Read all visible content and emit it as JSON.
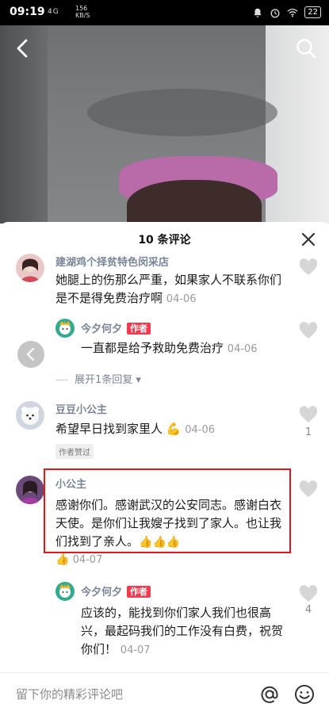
{
  "status": {
    "time": "09:19",
    "network": "4G",
    "speed_top": "156",
    "speed_bottom": "KB/S",
    "battery": "22"
  },
  "header": {
    "title": "10 条评论"
  },
  "comments": [
    {
      "name": "建湖鸡个择贫特色闵采店",
      "text": "她腿上的伤那么严重，如果家人不联系你们是不是得免费治疗啊",
      "date": "04-06"
    },
    {
      "reply_name": "今夕何夕",
      "badge": "作者",
      "reply_text": "一直都是给予救助免费治疗",
      "reply_date": "04-06",
      "expand": "展开1条回复"
    },
    {
      "name": "豆豆小公主",
      "text": "希望早日找到家里人",
      "date": "04-06",
      "likes": "1",
      "tag": "作者赞过"
    },
    {
      "name": "小公主",
      "text": "感谢你们。感谢武汉的公安同志。感谢白衣天使。是你们让我嫂子找到了家人。也让我们找到了亲人。",
      "date": "04-07"
    },
    {
      "reply_name": "今夕何夕",
      "badge": "作者",
      "reply_text": "应该的，能找到你们家人我们也很高兴，最起码我们的工作没有白费，祝贺你们！",
      "reply_date": "04-07",
      "likes": "4"
    }
  ],
  "input": {
    "placeholder": "留下你的精彩评论吧"
  },
  "colors": {
    "accent": "#f33b4f",
    "highlight": "#e4161c",
    "name": "#7a8596"
  }
}
